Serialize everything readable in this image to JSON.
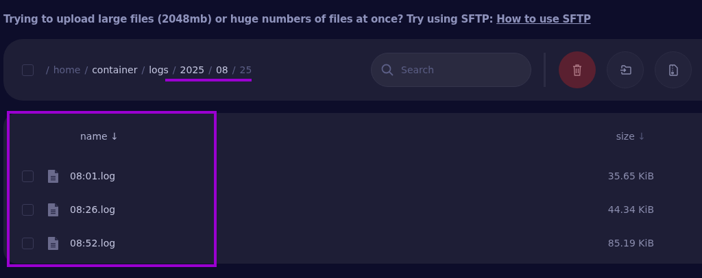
{
  "notice": {
    "text": "Trying to upload large files (2048mb) or huge numbers of files at once? Try using SFTP:",
    "link": "How to use SFTP"
  },
  "toolbar": {
    "select_all": {
      "checked": false
    },
    "breadcrumb": [
      {
        "label": "/",
        "muted": true
      },
      {
        "label": "home",
        "muted": true
      },
      {
        "label": "/",
        "muted": true
      },
      {
        "label": "container",
        "muted": false
      },
      {
        "label": "/",
        "muted": true
      },
      {
        "label": "logs",
        "muted": false
      },
      {
        "label": "/",
        "muted": true
      },
      {
        "label": "2025",
        "muted": false
      },
      {
        "label": "/",
        "muted": true
      },
      {
        "label": "08",
        "muted": false
      },
      {
        "label": "/",
        "muted": true
      },
      {
        "label": "25",
        "muted": true
      }
    ],
    "search": {
      "placeholder": "Search"
    }
  },
  "table": {
    "columns": [
      {
        "label": "name",
        "arrow": "↓"
      },
      {
        "label": "size",
        "arrow": "↓"
      }
    ],
    "rows": [
      {
        "name": "08:01.log",
        "size": "35.65 KiB",
        "checked": false
      },
      {
        "name": "08:26.log",
        "size": "44.34 KiB",
        "checked": false
      },
      {
        "name": "08:52.log",
        "size": "85.19 KiB",
        "checked": false
      }
    ]
  }
}
